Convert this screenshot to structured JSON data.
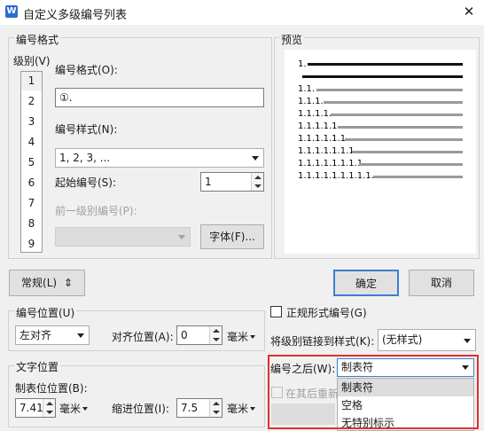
{
  "window": {
    "title": "自定义多级编号列表",
    "app_icon": "W"
  },
  "format_group": {
    "title": "编号格式",
    "level_label": "级别(V)",
    "levels": [
      "1",
      "2",
      "3",
      "4",
      "5",
      "6",
      "7",
      "8",
      "9"
    ],
    "number_format_label": "编号格式(O):",
    "number_format_value": "①.",
    "number_style_label": "编号样式(N):",
    "number_style_value": "1, 2, 3, ...",
    "start_number_label": "起始编号(S):",
    "start_number_value": "1",
    "prev_level_label": "前一级别编号(P):",
    "font_button": "字体(F)..."
  },
  "preview": {
    "title": "预览",
    "rows": [
      "1.",
      "1.1.",
      "1.1.1.",
      "1.1.1.1.",
      "1.1.1.1.1.",
      "1.1.1.1.1.1.",
      "1.1.1.1.1.1.1.",
      "1.1.1.1.1.1.1.1.",
      "1.1.1.1.1.1.1.1.1."
    ]
  },
  "buttons": {
    "normal": "常规(L)",
    "normal_icon": "⇕",
    "ok": "确定",
    "cancel": "取消"
  },
  "position_group": {
    "title": "编号位置(U)",
    "align_value": "左对齐",
    "align_pos_label": "对齐位置(A):",
    "align_pos_value": "0",
    "unit": "毫米"
  },
  "text_group": {
    "title": "文字位置",
    "tab_pos_label": "制表位位置(B):",
    "tab_pos_value": "7.41",
    "tab_unit": "毫米",
    "indent_label": "缩进位置(I):",
    "indent_value": "7.5",
    "indent_unit": "毫米"
  },
  "right_options": {
    "legal_numbering_label": "正规形式编号(G)",
    "link_style_label": "将级别链接到样式(K):",
    "link_style_value": "(无样式)",
    "after_number_label": "编号之后(W):",
    "after_number_value": "制表符",
    "restart_label": "在其后重新",
    "dropdown_options": [
      "制表符",
      "空格",
      "无特别标示"
    ]
  },
  "highlight_color": "#e03030"
}
